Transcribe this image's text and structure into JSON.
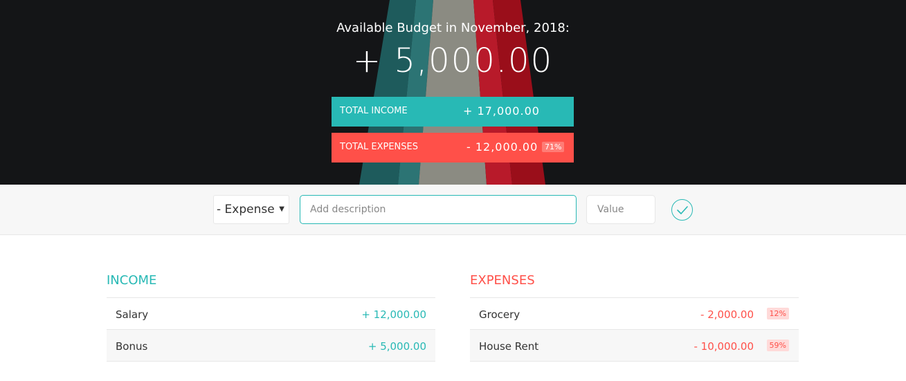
{
  "budget": {
    "title": "Available Budget in November, 2018:",
    "value": "+ 5,000.00",
    "income_label": "Total Income",
    "income_value": "+ 17,000.00",
    "expenses_label": "Total Expenses",
    "expenses_value": "- 12,000.00",
    "expenses_percentage": "71%"
  },
  "add": {
    "type_selected": "- Expense",
    "description_placeholder": "Add description",
    "value_placeholder": "Value",
    "submit_icon": "checkmark-circle-icon"
  },
  "income": {
    "title": "Income",
    "items": [
      {
        "description": "Salary",
        "value": "+ 12,000.00"
      },
      {
        "description": "Bonus",
        "value": "+ 5,000.00"
      }
    ]
  },
  "expenses": {
    "title": "Expenses",
    "items": [
      {
        "description": "Grocery",
        "value": "- 2,000.00",
        "percentage": "12%"
      },
      {
        "description": "House Rent",
        "value": "- 10,000.00",
        "percentage": "59%"
      }
    ]
  },
  "colors": {
    "income": "#28b9b5",
    "expenses": "#ff5049",
    "hero_bg": "#141517"
  }
}
